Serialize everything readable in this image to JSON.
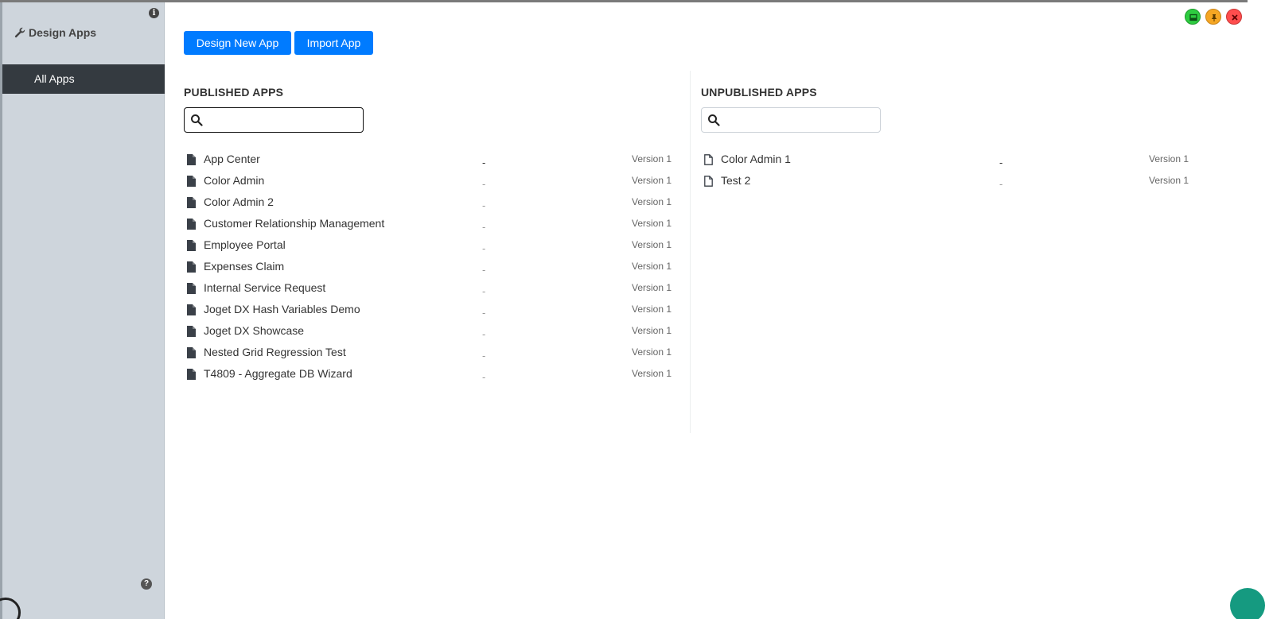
{
  "sidebar": {
    "title": "Design Apps",
    "nav": [
      {
        "label": "All Apps",
        "active": true
      }
    ]
  },
  "toolbar": {
    "design_label": "Design New App",
    "import_label": "Import App"
  },
  "published": {
    "title": "PUBLISHED APPS",
    "search_placeholder": "",
    "apps": [
      {
        "name": "App Center",
        "dash": "-",
        "version": "Version 1"
      },
      {
        "name": "Color Admin",
        "dash": "-",
        "version": "Version 1"
      },
      {
        "name": "Color Admin 2",
        "dash": "-",
        "version": "Version 1"
      },
      {
        "name": "Customer Relationship Management",
        "dash": "-",
        "version": "Version 1"
      },
      {
        "name": "Employee Portal",
        "dash": "-",
        "version": "Version 1"
      },
      {
        "name": "Expenses Claim",
        "dash": "-",
        "version": "Version 1"
      },
      {
        "name": "Internal Service Request",
        "dash": "-",
        "version": "Version 1"
      },
      {
        "name": "Joget DX Hash Variables Demo",
        "dash": "-",
        "version": "Version 1"
      },
      {
        "name": "Joget DX Showcase",
        "dash": "-",
        "version": "Version 1"
      },
      {
        "name": "Nested Grid Regression Test",
        "dash": "-",
        "version": "Version 1"
      },
      {
        "name": "T4809 - Aggregate DB Wizard",
        "dash": "-",
        "version": "Version 1"
      }
    ]
  },
  "unpublished": {
    "title": "UNPUBLISHED APPS",
    "search_placeholder": "",
    "apps": [
      {
        "name": "Color Admin 1",
        "dash": "-",
        "version": "Version 1"
      },
      {
        "name": "Test 2",
        "dash": "-",
        "version": "Version 1"
      }
    ]
  },
  "icons": {
    "sidebar_title": "wrench-icon",
    "info": "info-icon",
    "help": "help-icon",
    "search": "search-icon",
    "published_app": "file-solid-icon",
    "unpublished_app": "file-outline-icon",
    "window_controls": [
      "minimize-icon",
      "pin-icon",
      "close-icon"
    ]
  },
  "colors": {
    "primary": "#007bff",
    "sidebar_bg": "#ced5dc",
    "nav_active_bg": "#343a40",
    "ctrl_green": "#2ecc40",
    "ctrl_orange": "#f5a623",
    "ctrl_red": "#ff4d4d"
  }
}
